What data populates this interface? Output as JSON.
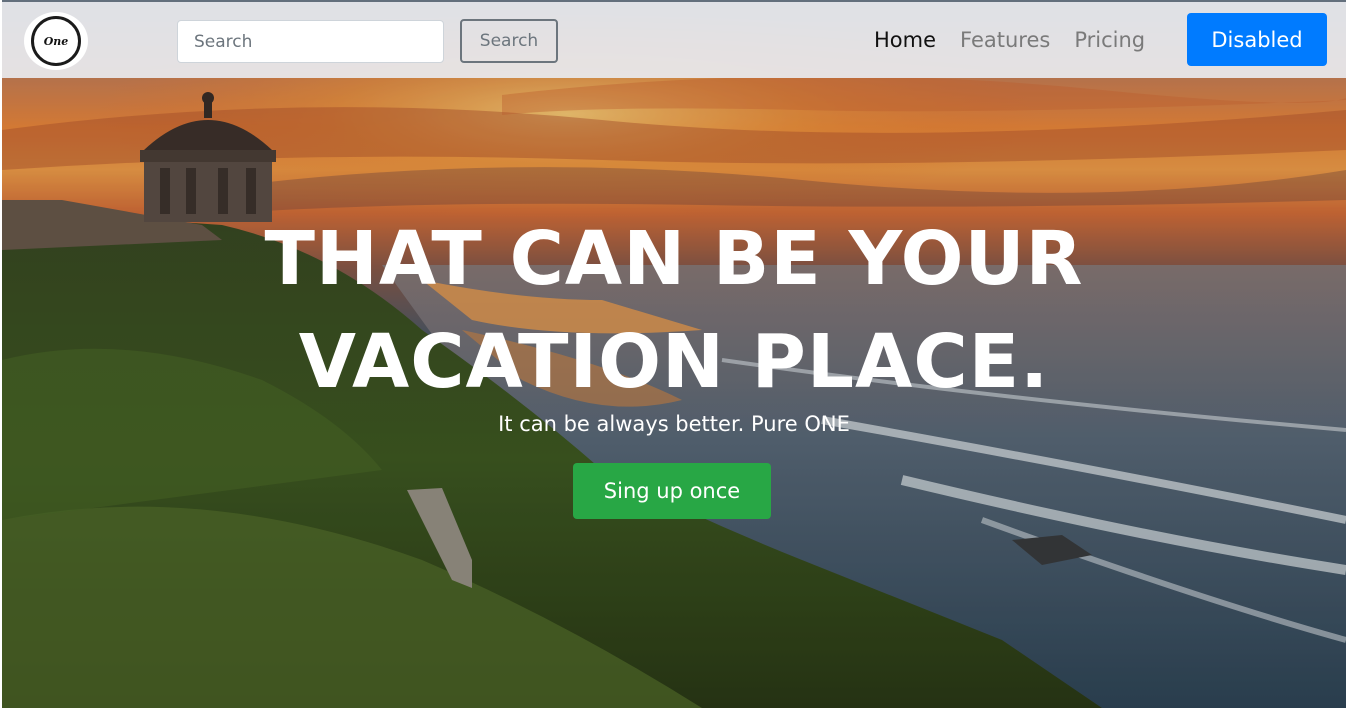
{
  "navbar": {
    "logo_text": "One",
    "search": {
      "placeholder": "Search",
      "button_label": "Search"
    },
    "links": [
      {
        "label": "Home",
        "active": true
      },
      {
        "label": "Features",
        "active": false
      },
      {
        "label": "Pricing",
        "active": false
      }
    ],
    "disabled_button_label": "Disabled"
  },
  "hero": {
    "headline_line1": "THAT CAN BE YOUR",
    "headline_line2": "VACATION PLACE.",
    "tagline": "It can be always better. Pure ONE",
    "cta_label": "Sing up once"
  },
  "colors": {
    "primary": "#007bff",
    "success": "#28a745",
    "secondary": "#6c757d",
    "navbar_bg": "#e8eaee"
  }
}
